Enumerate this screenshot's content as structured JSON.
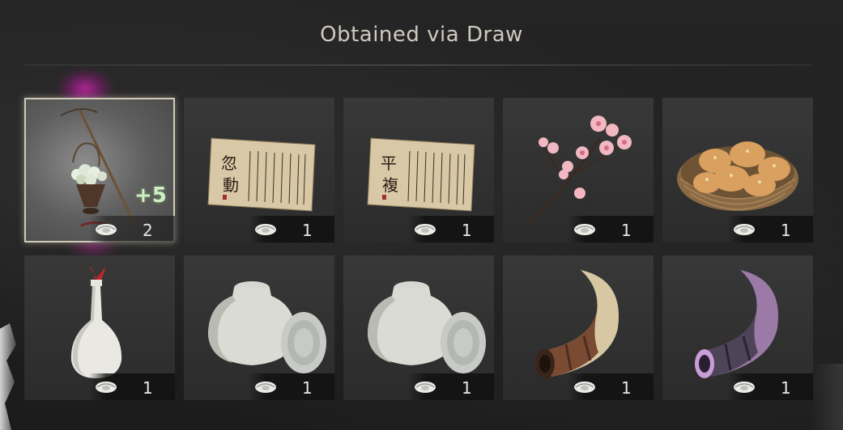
{
  "title": "Obtained via Draw",
  "colors": {
    "background": "#1f1f1f",
    "slot_background": "#333333",
    "highlight_border": "#cfcbb8",
    "highlight_glow": "#c828aa",
    "bonus_text": "#cfeec3"
  },
  "currency_icon": "coin-icon",
  "items": [
    {
      "name": "Flower Vase Pole",
      "icon": "flower-pole-icon",
      "quantity": "2",
      "bonus": "+5",
      "highlighted": true
    },
    {
      "name": "Calligraphy Scroll I",
      "icon": "scroll-icon",
      "quantity": "1",
      "bonus": "",
      "highlighted": false
    },
    {
      "name": "Calligraphy Scroll II",
      "icon": "scroll-icon",
      "quantity": "1",
      "bonus": "",
      "highlighted": false
    },
    {
      "name": "Plum Blossom Branch",
      "icon": "blossom-branch-icon",
      "quantity": "1",
      "bonus": "",
      "highlighted": false
    },
    {
      "name": "Basket of Buns",
      "icon": "bun-basket-icon",
      "quantity": "1",
      "bonus": "",
      "highlighted": false
    },
    {
      "name": "White Porcelain Bottle",
      "icon": "porcelain-bottle-icon",
      "quantity": "1",
      "bonus": "",
      "highlighted": false
    },
    {
      "name": "Lidded Jar I",
      "icon": "lidded-jar-icon",
      "quantity": "1",
      "bonus": "",
      "highlighted": false
    },
    {
      "name": "Lidded Jar II",
      "icon": "lidded-jar-icon",
      "quantity": "1",
      "bonus": "",
      "highlighted": false
    },
    {
      "name": "Bone Horn",
      "icon": "horn-icon",
      "quantity": "1",
      "bonus": "",
      "highlighted": false
    },
    {
      "name": "Violet Horn",
      "icon": "horn-violet-icon",
      "quantity": "1",
      "bonus": "",
      "highlighted": false
    }
  ]
}
